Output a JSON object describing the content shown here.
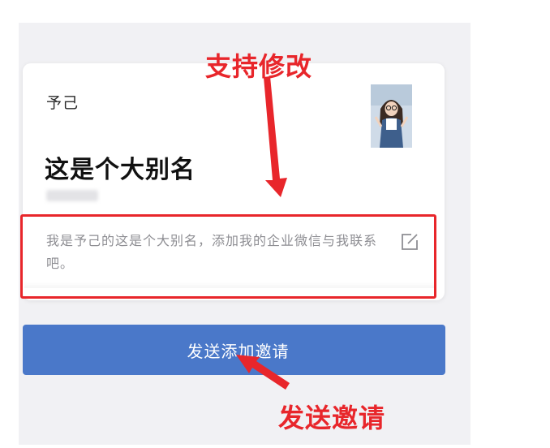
{
  "card": {
    "username": "予己",
    "alias": "这是个大别名",
    "message": "我是予己的这是个大别名，添加我的企业微信与我联系吧。"
  },
  "actions": {
    "send_button_label": "发送添加邀请"
  },
  "annotations": {
    "edit_label": "支持修改",
    "send_label": "发送邀请"
  },
  "colors": {
    "primary_button": "#4a78c9",
    "annotation_red": "#e8262b"
  },
  "icons": {
    "edit": "edit-icon"
  }
}
